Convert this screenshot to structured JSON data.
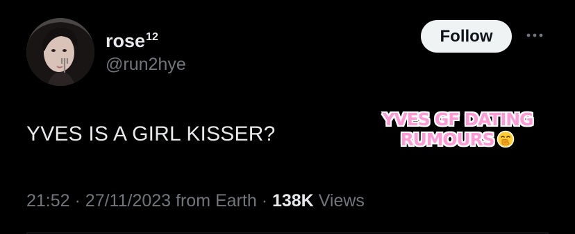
{
  "author": {
    "display_name": "rose",
    "display_name_superscript": "12",
    "handle": "@run2hye",
    "avatar": "profile-photo"
  },
  "actions": {
    "follow_label": "Follow",
    "more_icon": "ellipsis-icon"
  },
  "tweet": {
    "text": "YVES IS A GIRL KISSER?"
  },
  "overlay": {
    "line1": "YVES GF DATING",
    "line2": "RUMOURS",
    "emoji": "hand-over-mouth-emoji",
    "color": "#ff9ad6"
  },
  "meta": {
    "time": "21:52",
    "separator": "·",
    "date": "27/11/2023",
    "source": "from Earth",
    "views_count": "138K",
    "views_label": "Views"
  },
  "colors": {
    "background": "#000000",
    "primary_text": "#e7e9ea",
    "secondary_text": "#71767b",
    "button_bg": "#eff3f4"
  }
}
